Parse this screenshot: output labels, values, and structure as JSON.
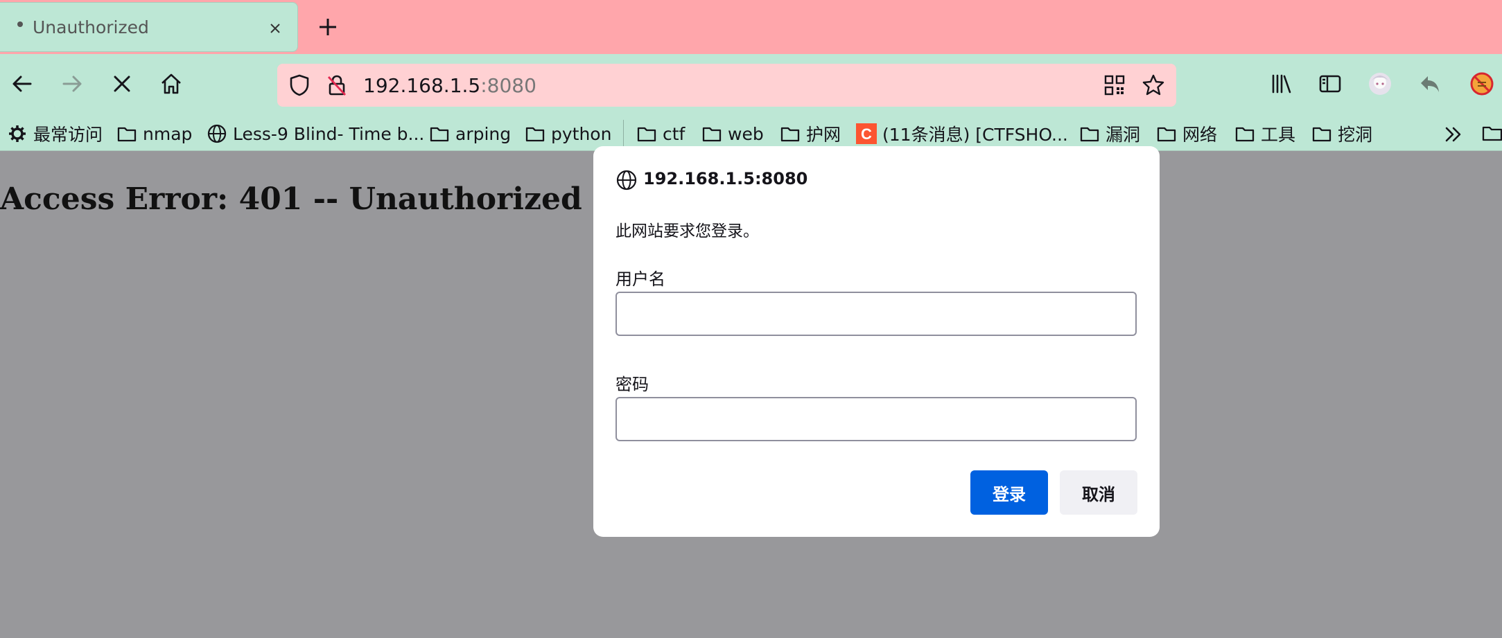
{
  "tab": {
    "title": "Unauthorized",
    "close_icon": "close-icon",
    "new_tab_icon": "plus-icon"
  },
  "navbar": {
    "back_icon": "arrow-left-icon",
    "forward_icon": "arrow-right-icon",
    "stop_icon": "close-icon",
    "home_icon": "home-icon",
    "url_host": "192.168.1.5",
    "url_port": ":8080",
    "tools": [
      "library-icon",
      "sidebar-icon",
      "avatar",
      "undo-icon",
      "blocked-extension-icon"
    ]
  },
  "bookmarks": {
    "items": [
      {
        "label": "最常访问",
        "icon": "gear-icon"
      },
      {
        "label": "nmap",
        "icon": "folder-icon"
      },
      {
        "label": "Less-9 Blind- Time b...",
        "icon": "globe-icon"
      },
      {
        "label": "arping",
        "icon": "folder-icon"
      },
      {
        "label": "python",
        "icon": "folder-icon"
      },
      {
        "label": "ctf",
        "icon": "folder-icon"
      },
      {
        "label": "web",
        "icon": "folder-icon"
      },
      {
        "label": "护网",
        "icon": "folder-icon"
      },
      {
        "label": "(11条消息) [CTFSHO...",
        "icon": "csdn-logo-icon"
      },
      {
        "label": "漏洞",
        "icon": "folder-icon"
      },
      {
        "label": "网络",
        "icon": "folder-icon"
      },
      {
        "label": "工具",
        "icon": "folder-icon"
      },
      {
        "label": "挖洞",
        "icon": "folder-icon"
      }
    ],
    "csdn_logo_letter": "C"
  },
  "page": {
    "heading": "Access Error: 401 -- Unauthorized"
  },
  "dialog": {
    "origin": "192.168.1.5:8080",
    "message": "此网站要求您登录。",
    "username_label": "用户名",
    "username_value": "",
    "password_label": "密码",
    "password_value": "",
    "login_button": "登录",
    "cancel_button": "取消"
  },
  "colors": {
    "tabstrip_bg": "#ffa6ab",
    "toolbar_bg": "#bde7d5",
    "urlbar_bg": "#ffd1d3",
    "page_overlay": "#98989b",
    "primary_button": "#0061e0",
    "csdn_red": "#fc5531"
  }
}
